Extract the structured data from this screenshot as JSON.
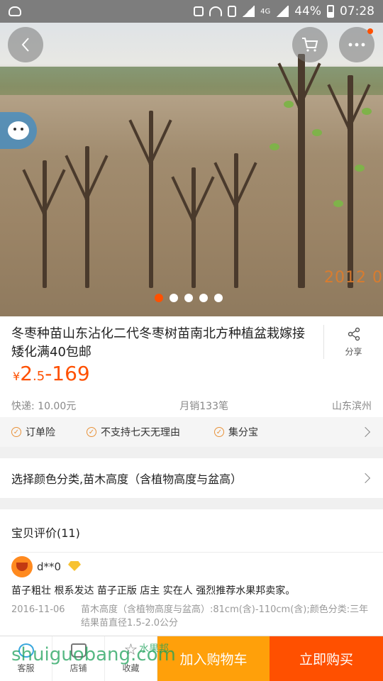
{
  "status_bar": {
    "battery": "44%",
    "time": "07:28",
    "network": "4G"
  },
  "hero": {
    "photo_date_stamp": "2012  0",
    "carousel_count": 5,
    "carousel_active": 0
  },
  "product": {
    "title": "冬枣种苗山东沾化二代冬枣树苗南北方种植盆栽嫁接矮化满40包邮",
    "share_label": "分享",
    "price_symbol": "¥",
    "price_low_int": "2",
    "price_low_dec": ".5",
    "price_high": "-169",
    "shipping": "快递: 10.00元",
    "monthly_sales": "月销133笔",
    "location": "山东滨州",
    "services": [
      "订单险",
      "不支持七天无理由",
      "集分宝"
    ]
  },
  "sku": {
    "label": "选择颜色分类,苗木高度（含植物高度与盆高）"
  },
  "reviews": {
    "header": "宝贝评价(11)",
    "user": "d**0",
    "text": "苗子粗壮 根系发达 苗子正版 店主 实在人 强烈推荐水果邦卖家。",
    "date": "2016-11-06",
    "sku_info": "苗木高度（含植物高度与盆高）:81cm(含)-110cm(含);颜色分类:三年结果苗直径1.5-2.0公分"
  },
  "bottom_bar": {
    "service_label": "客服",
    "shop_label": "店铺",
    "favorite_label": "收藏",
    "add_cart_label": "加入购物车",
    "buy_now_label": "立即购买"
  },
  "watermark": {
    "site": "shuiguobang.com",
    "cn": "水果邦"
  },
  "colors": {
    "accent": "#ff5000",
    "cart": "#ffa00a"
  }
}
